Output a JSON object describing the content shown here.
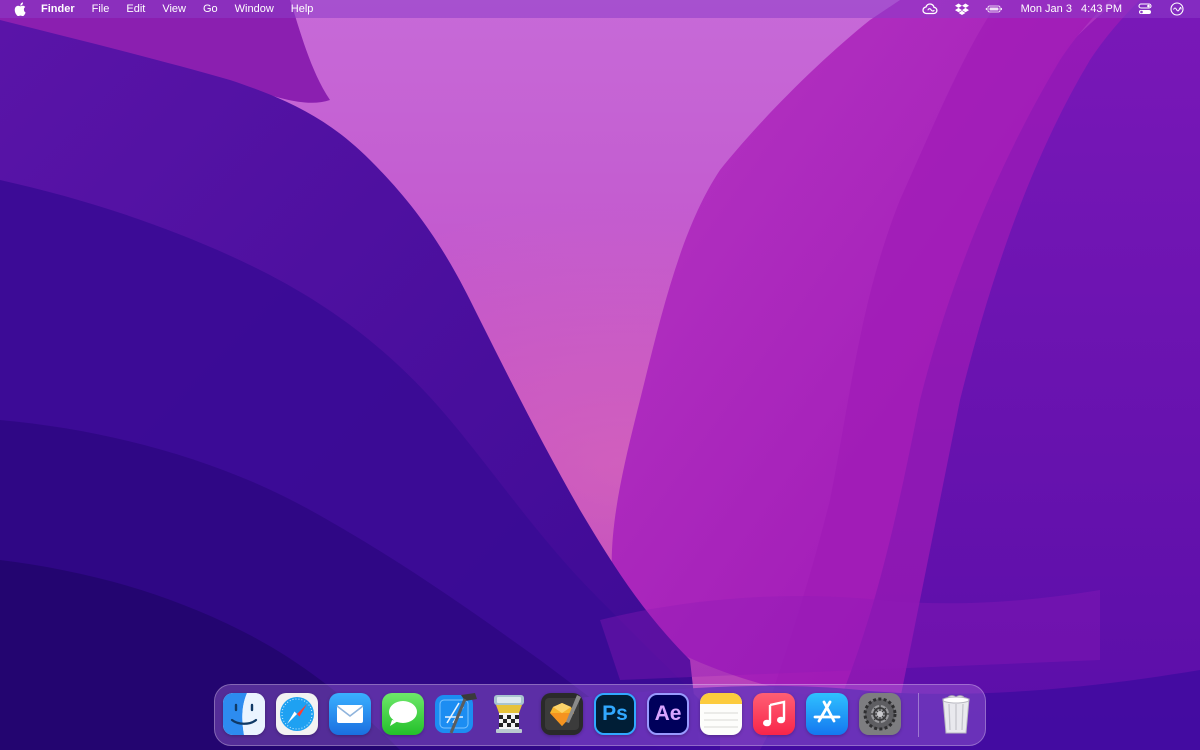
{
  "menubar": {
    "app_name": "Finder",
    "menus": [
      "File",
      "Edit",
      "View",
      "Go",
      "Window",
      "Help"
    ],
    "clock": {
      "date": "Mon Jan 3",
      "time": "4:43 PM"
    },
    "status_icons": [
      "creative-cloud-icon",
      "dropbox-icon",
      "battery-icon",
      "control-center-icon",
      "siri-icon"
    ]
  },
  "dock": {
    "apps": [
      {
        "name": "Finder",
        "icon": "finder-icon"
      },
      {
        "name": "Safari",
        "icon": "safari-icon"
      },
      {
        "name": "Mail",
        "icon": "mail-icon"
      },
      {
        "name": "Messages",
        "icon": "messages-icon"
      },
      {
        "name": "Xcode",
        "icon": "xcode-icon"
      },
      {
        "name": "Transmit",
        "icon": "tower-icon"
      },
      {
        "name": "Sketch",
        "icon": "sketch-icon"
      },
      {
        "name": "Photoshop",
        "icon": "photoshop-icon",
        "label": "Ps"
      },
      {
        "name": "After Effects",
        "icon": "after-effects-icon",
        "label": "Ae"
      },
      {
        "name": "Notes",
        "icon": "notes-icon"
      },
      {
        "name": "Music",
        "icon": "music-icon"
      },
      {
        "name": "App Store",
        "icon": "app-store-icon"
      },
      {
        "name": "System Preferences",
        "icon": "system-preferences-icon"
      },
      {
        "name": "Trash",
        "icon": "trash-icon"
      }
    ]
  },
  "colors": {
    "wallpaper_top": "#c45fd6",
    "wallpaper_deep": "#3a0a8c",
    "wallpaper_magenta": "#a51fb8"
  }
}
